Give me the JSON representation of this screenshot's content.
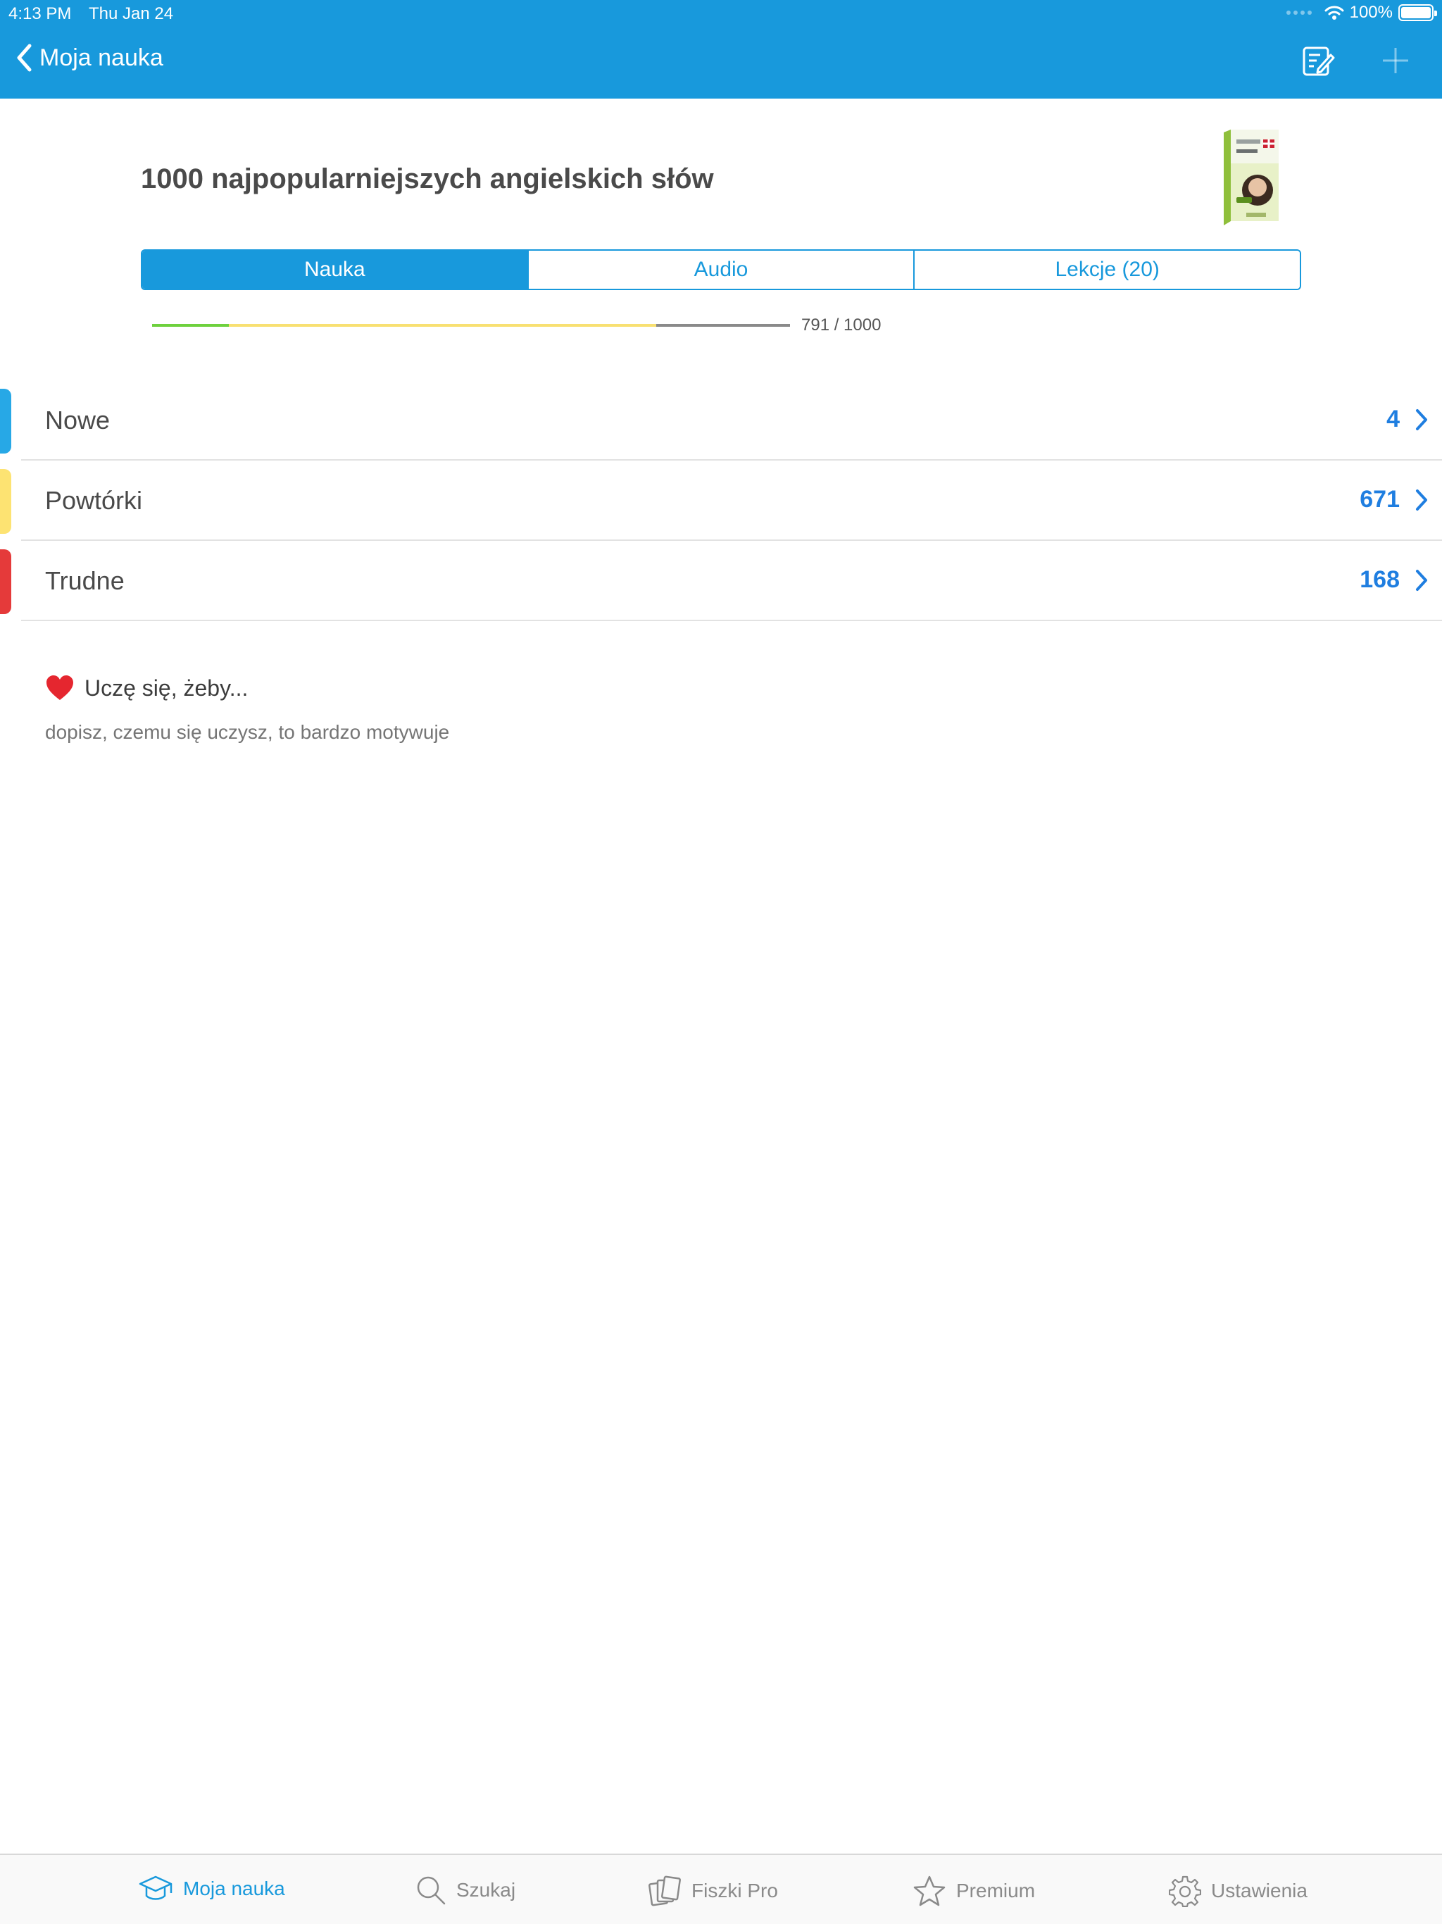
{
  "status": {
    "time": "4:13 PM",
    "date": "Thu Jan 24",
    "battery": "100%"
  },
  "nav": {
    "back_label": "Moja nauka"
  },
  "course": {
    "title": "1000 najpopularniejszych angielskich słów"
  },
  "tabs": [
    {
      "label": "Nauka",
      "active": true
    },
    {
      "label": "Audio",
      "active": false
    },
    {
      "label": "Lekcje (20)",
      "active": false
    }
  ],
  "progress": {
    "label": "791 / 1000",
    "segments": {
      "green": 0.12,
      "yellow": 0.67,
      "gray": 0.21
    },
    "colors": {
      "green": "#6ed13e",
      "yellow": "#f8e072",
      "gray": "#8a8a8a"
    }
  },
  "sections": [
    {
      "label": "Nowe",
      "count": "4",
      "color": "#27a8e6"
    },
    {
      "label": "Powtórki",
      "count": "671",
      "color": "#fde372"
    },
    {
      "label": "Trudne",
      "count": "168",
      "color": "#e53a3a"
    }
  ],
  "motivation": {
    "title": "Uczę się, żeby...",
    "placeholder": "dopisz, czemu się uczysz, to bardzo motywuje"
  },
  "tabbar": [
    {
      "label": "Moja nauka",
      "icon": "graduation-cap-icon",
      "active": true
    },
    {
      "label": "Szukaj",
      "icon": "search-icon",
      "active": false
    },
    {
      "label": "Fiszki Pro",
      "icon": "cards-icon",
      "active": false
    },
    {
      "label": "Premium",
      "icon": "star-icon",
      "active": false
    },
    {
      "label": "Ustawienia",
      "icon": "gear-icon",
      "active": false
    }
  ],
  "colors": {
    "accent": "#1899dc",
    "count_blue": "#1f7ee0"
  }
}
